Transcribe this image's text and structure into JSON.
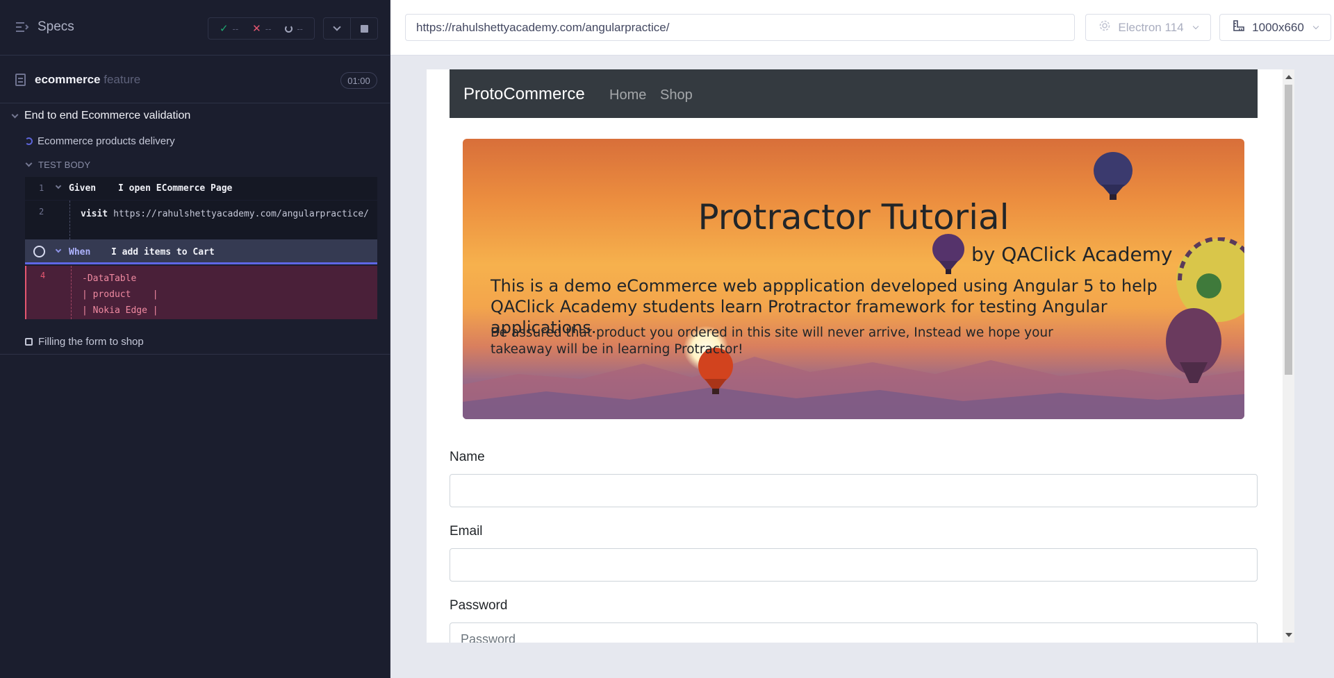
{
  "reporter": {
    "specs_label": "Specs",
    "stats": {
      "passed": "--",
      "failed": "--",
      "pending": "--"
    },
    "spec": {
      "name": "ecommerce",
      "ext": "feature",
      "duration": "01:00"
    },
    "suite_title": "End to end Ecommerce validation",
    "tests": [
      {
        "title": "Ecommerce products delivery",
        "state": "running"
      },
      {
        "title": "Filling the form to shop",
        "state": "pending"
      }
    ],
    "section_label": "TEST BODY",
    "commands": [
      {
        "num": "1",
        "keyword": "Given",
        "text": "I open ECommerce Page"
      },
      {
        "num": "2",
        "keyword": "visit",
        "text": "https://rahulshettyacademy.com/angularpractice/"
      },
      {
        "num": "",
        "keyword": "When",
        "text": "I add items to Cart"
      },
      {
        "num": "4",
        "keyword": "",
        "text": "-DataTable\n| product    |\n| Nokia Edge |"
      }
    ]
  },
  "browser": {
    "url": "https://rahulshettyacademy.com/angularpractice/",
    "browser_name": "Electron 114",
    "viewport": "1000x660"
  },
  "app": {
    "brand": "ProtoCommerce",
    "nav": [
      "Home",
      "Shop"
    ],
    "hero": {
      "title": "Protractor Tutorial",
      "subtitle": "by QAClick Academy",
      "para1": "This is a demo eCommerce web appplication developed using Angular 5 to help QAClick Academy students learn Protractor framework for testing Angular applications.",
      "para2": "Be assured that product you ordered in this site will never arrive, Instead we hope your takeaway will be in learning Protractor!"
    },
    "form": {
      "name_label": "Name",
      "name_value": "",
      "email_label": "Email",
      "email_value": "",
      "password_label": "Password",
      "password_placeholder": "Password"
    }
  },
  "colors": {
    "reporter_bg": "#1b1e2e",
    "accent": "#5f67e6",
    "pass": "#1fa971",
    "fail": "#e45770",
    "navbar": "#343a40"
  },
  "icons": [
    "menu-lines-icon",
    "check-icon",
    "x-icon",
    "spinner-icon",
    "chevron-down-icon",
    "stop-icon",
    "file-icon",
    "gear-icon",
    "ruler-icon"
  ]
}
